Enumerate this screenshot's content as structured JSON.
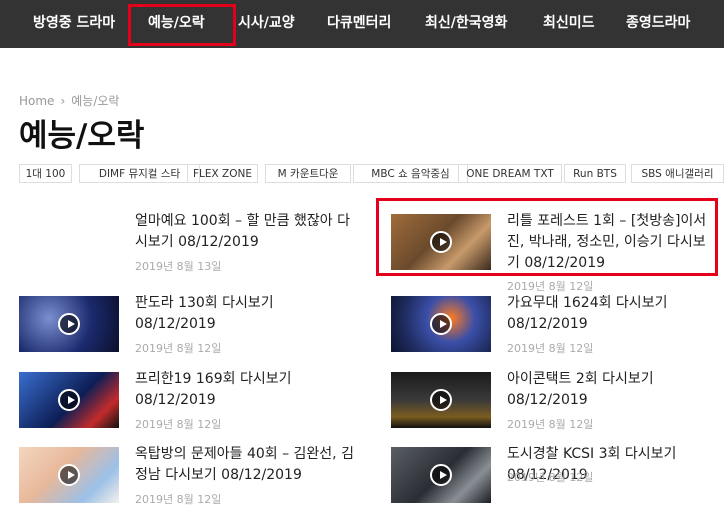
{
  "nav": {
    "items": [
      "방영중 드라마",
      "예능/오락",
      "시사/교양",
      "다큐멘터리",
      "최신/한국영화",
      "최신미드",
      "종영드라마"
    ]
  },
  "breadcrumb": {
    "home": "Home",
    "separator": "›",
    "current": "예능/오락"
  },
  "page_title": "예능/오락",
  "tags": [
    "1대 100",
    "DIMF 뮤지컬 스타",
    "FLEX ZONE",
    "M 카운트다운",
    "MBC 쇼 음악중심",
    "ONE DREAM TXT",
    "Run BTS",
    "SBS 애니갤러리"
  ],
  "posts": [
    {
      "title": "얼마예요 100회 – 할 만큼 했잖아 다시보기 08/12/2019",
      "date": "2019년 8월 13일",
      "thumb": "none"
    },
    {
      "title": "리틀 포레스트 1회 – [첫방송]이서진, 박나래, 정소민, 이승기 다시보기 08/12/2019",
      "date": "2019년 8월 12일",
      "thumb": "brown"
    },
    {
      "title": "판도라 130회 다시보기 08/12/2019",
      "date": "2019년 8월 12일",
      "thumb": "studio"
    },
    {
      "title": "가요무대 1624회 다시보기 08/12/2019",
      "date": "2019년 8월 12일",
      "thumb": "flowers"
    },
    {
      "title": "프리한19 169회 다시보기 08/12/2019",
      "date": "2019년 8월 12일",
      "thumb": "blue"
    },
    {
      "title": "아이콘택트 2회 다시보기 08/12/2019",
      "date": "2019년 8월 12일",
      "thumb": "dark"
    },
    {
      "title": "옥탑방의 문제아들 40회 – 김완선, 김정남 다시보기 08/12/2019",
      "date": "2019년 8월 12일",
      "thumb": "light"
    },
    {
      "title": "도시경찰 KCSI 3회 다시보기 08/12/2019",
      "date": "2019년 8월 12일",
      "thumb": "police"
    }
  ],
  "colors": {
    "nav_bg": "#333333",
    "highlight": "#e4001b"
  }
}
